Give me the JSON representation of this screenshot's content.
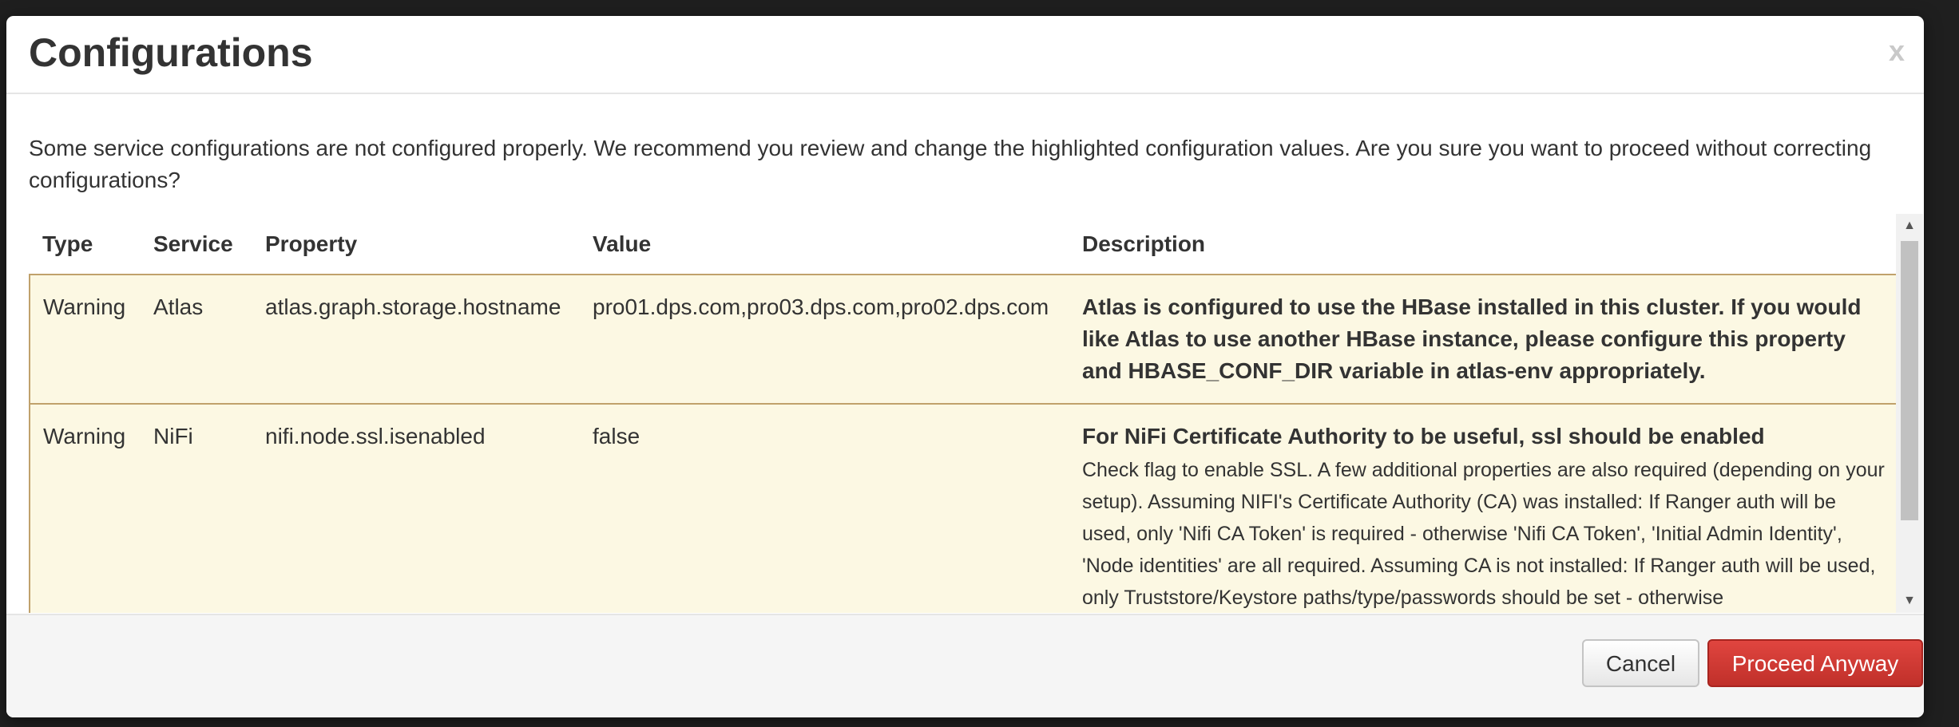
{
  "dialog": {
    "title": "Configurations",
    "close_label": "x",
    "message": "Some service configurations are not configured properly. We recommend you review and change the highlighted configuration values. Are you sure you want to proceed without correcting configurations?"
  },
  "table": {
    "headers": [
      "Type",
      "Service",
      "Property",
      "Value",
      "Description"
    ],
    "rows": [
      {
        "type": "Warning",
        "service": "Atlas",
        "property": "atlas.graph.storage.hostname",
        "value": "pro01.dps.com,pro03.dps.com,pro02.dps.com",
        "description": "Atlas is configured to use the HBase installed in this cluster. If you would like Atlas to use another HBase instance, please configure this property and HBASE_CONF_DIR variable in atlas-env appropriately.",
        "detail": ""
      },
      {
        "type": "Warning",
        "service": "NiFi",
        "property": "nifi.node.ssl.isenabled",
        "value": "false",
        "description": "For NiFi Certificate Authority to be useful, ssl should be enabled",
        "detail": "Check flag to enable SSL. A few additional properties are also required (depending on your setup). Assuming NIFI's Certificate Authority (CA) was installed: If Ranger auth will be used, only 'Nifi CA Token' is required - otherwise 'Nifi CA Token', 'Initial Admin Identity', 'Node identities' are all required. Assuming CA is not installed: If Ranger auth will be used, only Truststore/Keystore paths/type/passwords should be set - otherwise Truststore/Keystore paths/type/passwords as well as 'Initial Admin Identity', 'Node identities' are all required."
      }
    ]
  },
  "footer": {
    "cancel_label": "Cancel",
    "proceed_label": "Proceed Anyway"
  },
  "colors": {
    "warning_row_bg": "#fcf8e3",
    "warning_row_border": "#c0a16b",
    "danger_button": "#cd3a35"
  }
}
